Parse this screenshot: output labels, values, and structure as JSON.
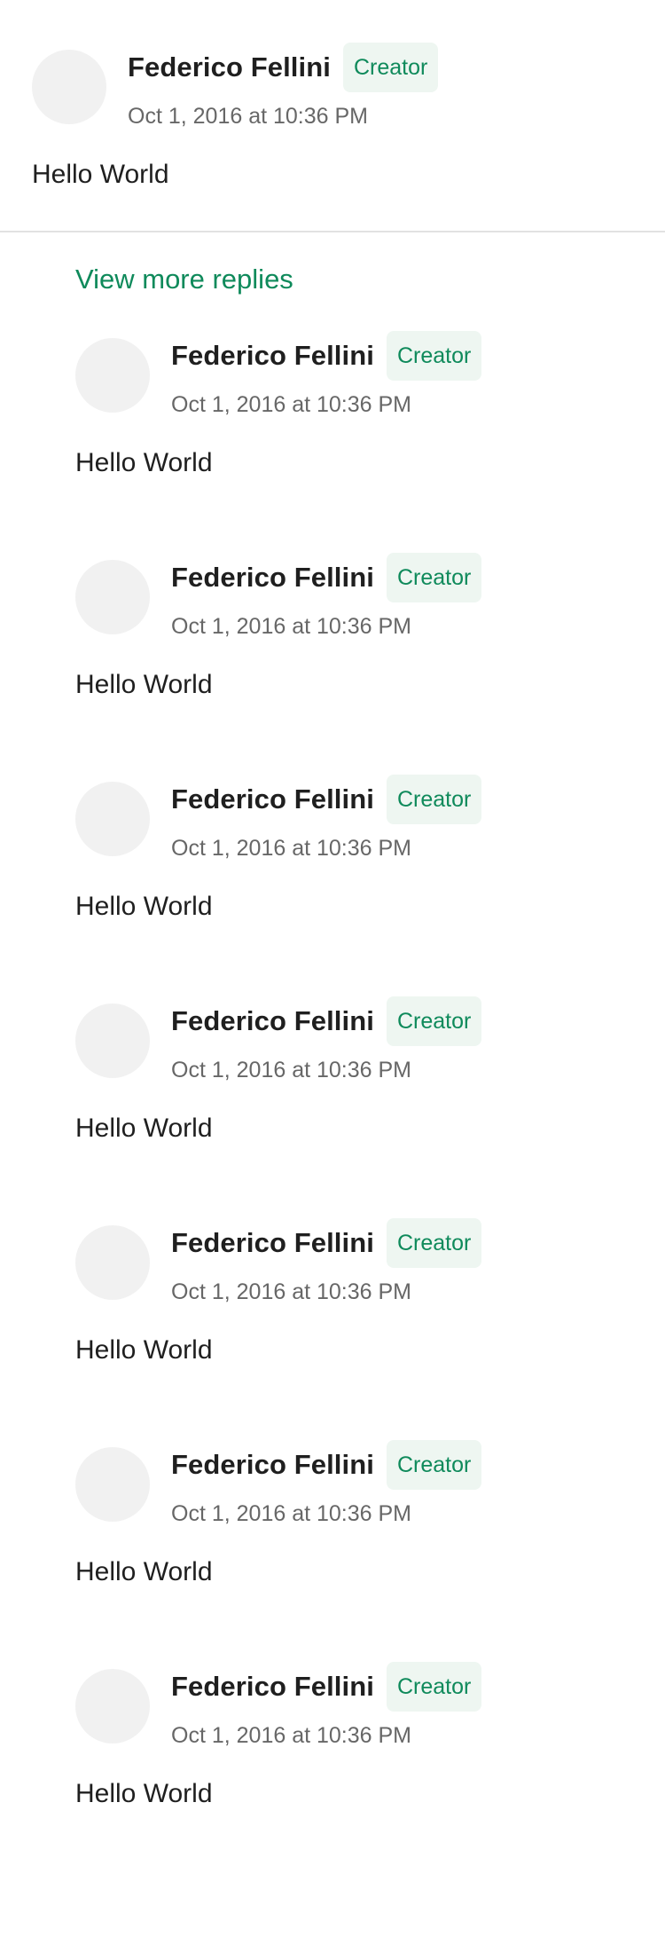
{
  "top_comment": {
    "author": "Federico Fellini",
    "badge": "Creator",
    "timestamp": "Oct 1, 2016 at 10:36 PM",
    "body": "Hello World"
  },
  "replies_section": {
    "view_more_label": "View more replies"
  },
  "replies": [
    {
      "author": "Federico Fellini",
      "badge": "Creator",
      "timestamp": "Oct 1, 2016 at 10:36 PM",
      "body": "Hello World"
    },
    {
      "author": "Federico Fellini",
      "badge": "Creator",
      "timestamp": "Oct 1, 2016 at 10:36 PM",
      "body": "Hello World"
    },
    {
      "author": "Federico Fellini",
      "badge": "Creator",
      "timestamp": "Oct 1, 2016 at 10:36 PM",
      "body": "Hello World"
    },
    {
      "author": "Federico Fellini",
      "badge": "Creator",
      "timestamp": "Oct 1, 2016 at 10:36 PM",
      "body": "Hello World"
    },
    {
      "author": "Federico Fellini",
      "badge": "Creator",
      "timestamp": "Oct 1, 2016 at 10:36 PM",
      "body": "Hello World"
    },
    {
      "author": "Federico Fellini",
      "badge": "Creator",
      "timestamp": "Oct 1, 2016 at 10:36 PM",
      "body": "Hello World"
    },
    {
      "author": "Federico Fellini",
      "badge": "Creator",
      "timestamp": "Oct 1, 2016 at 10:36 PM",
      "body": "Hello World"
    }
  ],
  "colors": {
    "accent": "#0f8a5b",
    "badge_background": "#eef6f1",
    "avatar_placeholder": "#f1f1f1",
    "divider": "#e2e2e2",
    "muted_text": "#676767"
  }
}
